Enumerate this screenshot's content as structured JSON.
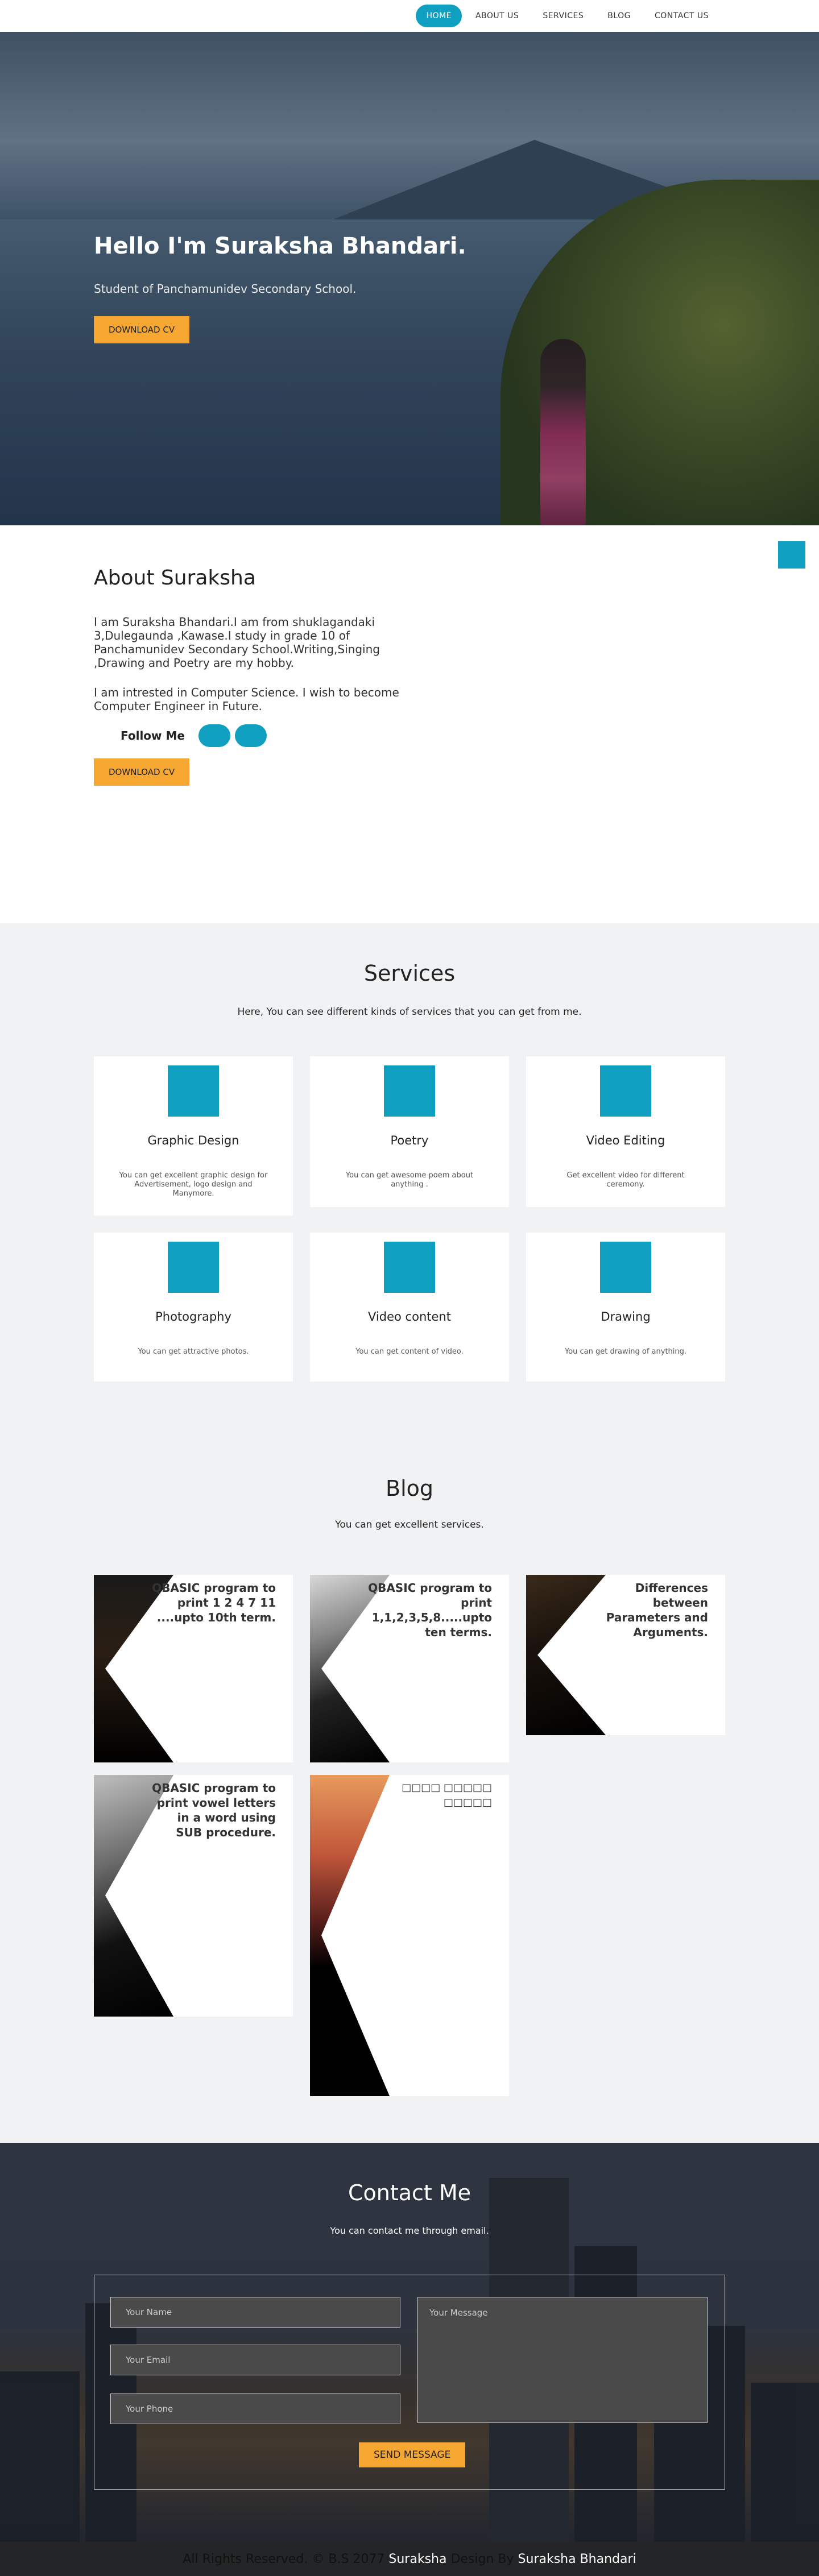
{
  "nav": {
    "items": [
      {
        "label": "HOME",
        "active": true
      },
      {
        "label": "ABOUT US",
        "active": false
      },
      {
        "label": "SERVICES",
        "active": false
      },
      {
        "label": "BLOG",
        "active": false
      },
      {
        "label": "CONTACT US",
        "active": false
      }
    ]
  },
  "hero": {
    "title": "Hello I'm Suraksha Bhandari.",
    "subtitle": "Student of Panchamunidev Secondary School.",
    "cta": "DOWNLOAD CV"
  },
  "about": {
    "side_icon": "",
    "title": "About Suraksha",
    "para1": "I am Suraksha Bhandari.I am from shuklagandaki 3,Dulegaunda ,Kawase.I study in grade 10 of Panchamunidev Secondary School.Writing,Singing ,Drawing and Poetry are my hobby.",
    "para2": "I am intrested in Computer Science. I wish to become Computer Engineer in Future.",
    "follow_label": "Follow Me",
    "social_icons": [
      "",
      ""
    ],
    "cta": "DOWNLOAD CV"
  },
  "services": {
    "title": "Services",
    "subtitle": "Here, You can see different kinds of services that you can get from me.",
    "items": [
      {
        "icon": "",
        "title": "Graphic Design",
        "desc": "You can get excellent graphic design for Advertisement, logo design and Manymore."
      },
      {
        "icon": "",
        "title": "Poetry",
        "desc": "You can get awesome poem about anything ."
      },
      {
        "icon": "",
        "title": "Video Editing",
        "desc": "Get excellent video for different ceremony."
      },
      {
        "icon": "",
        "title": "Photography",
        "desc": "You can get attractive photos."
      },
      {
        "icon": "",
        "title": "Video content",
        "desc": "You can get content of video."
      },
      {
        "icon": "",
        "title": "Drawing",
        "desc": "You can get drawing of anything."
      }
    ]
  },
  "blog": {
    "title": "Blog",
    "subtitle": "You can get excellent services.",
    "posts": [
      {
        "title": "QBASIC program to print 1 2 4 7 11 ....upto 10th term."
      },
      {
        "title": "QBASIC program to print 1,1,2,3,5,8.....upto ten terms."
      },
      {
        "title": "Differences between Parameters and Arguments."
      },
      {
        "title": "QBASIC program to print vowel letters in a word using SUB procedure."
      },
      {
        "title": "□□□□ □□□□□ □□□□□"
      }
    ]
  },
  "contact": {
    "title": "Contact Me",
    "subtitle": "You can contact me through email.",
    "name_placeholder": "Your Name",
    "email_placeholder": "Your Email",
    "phone_placeholder": "Your Phone",
    "message_placeholder": "Your Message",
    "submit": "SEND MESSAGE"
  },
  "footer": {
    "prefix": "All Rights Reserved. © B.S 2077",
    "name": "Suraksha",
    "middle": "Design By",
    "designer": "Suraksha Bhandari"
  }
}
